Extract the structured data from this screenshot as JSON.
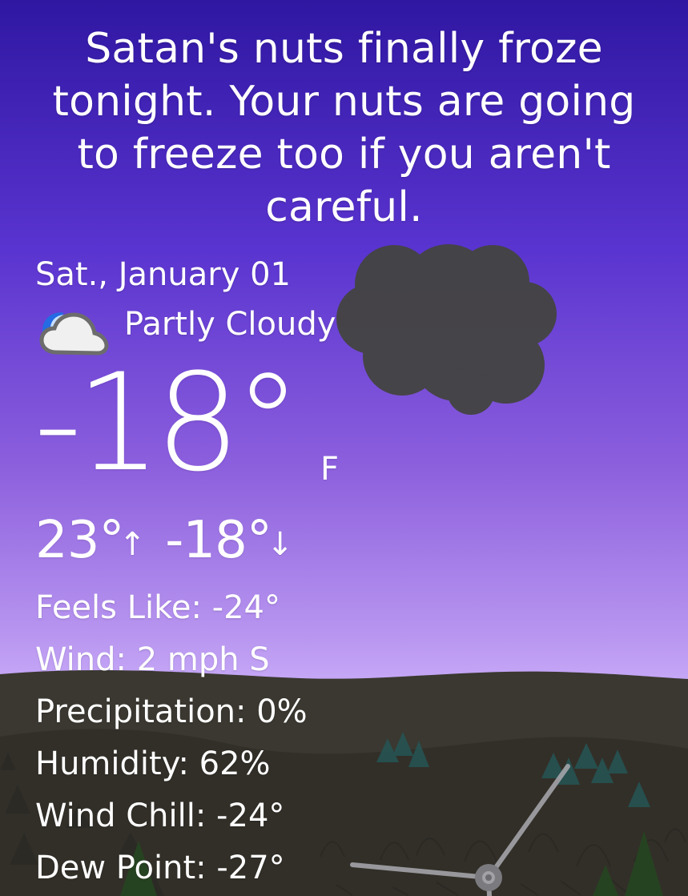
{
  "headline": "Satan's nuts finally froze tonight. Your nuts are going to freeze too if you aren't careful.",
  "date": "Sat., January 01",
  "condition": {
    "label": "Partly Cloudy",
    "icon": "moon-cloud-icon"
  },
  "temperature": {
    "current": "-18°",
    "unit": "F",
    "high": "23°",
    "high_arrow": "↑",
    "low": "-18°",
    "low_arrow": "↓"
  },
  "details": [
    {
      "label": "Feels Like: -24°"
    },
    {
      "label": "Wind: 2 mph S"
    },
    {
      "label": "Precipitation: 0%"
    },
    {
      "label": "Humidity: 62%"
    },
    {
      "label": "Wind Chill: -24°"
    },
    {
      "label": "Dew Point: -27°"
    }
  ],
  "colors": {
    "sky_top": "#2f17a2",
    "sky_bottom": "#d8c0ff",
    "cloud": "#444444",
    "ground": "#333129"
  },
  "icons": {
    "storm_cloud": "storm-cloud-icon",
    "wind_turbine": "wind-turbine-icon",
    "trees": "tree-icon"
  }
}
